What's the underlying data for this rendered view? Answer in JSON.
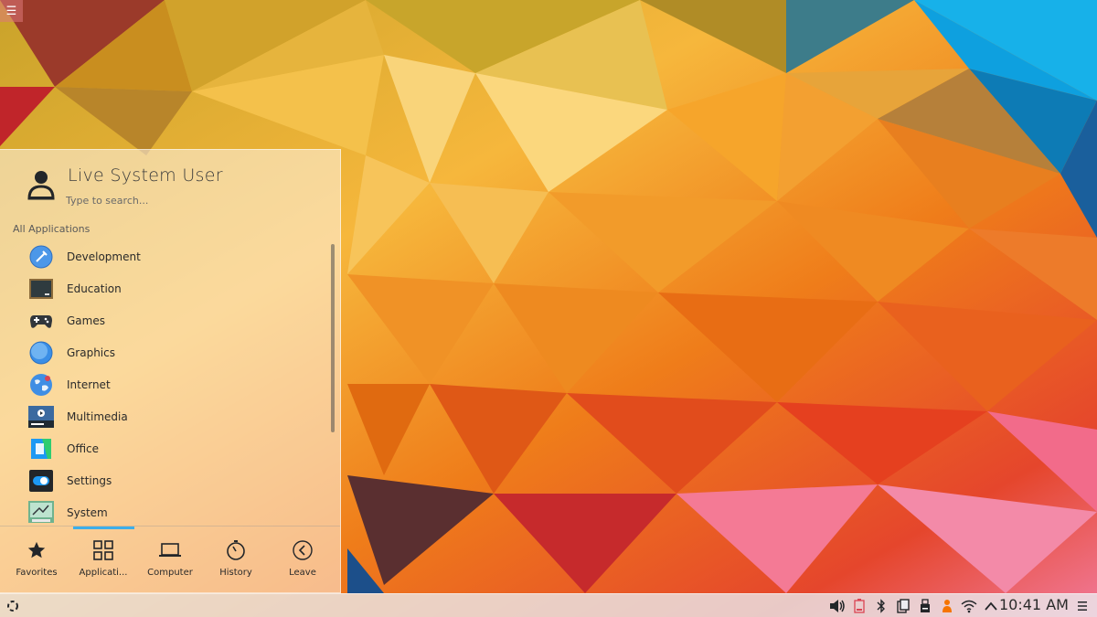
{
  "launcher": {
    "user_name": "Live System User",
    "search_placeholder": "Type to search...",
    "section_title": "All Applications",
    "applications": [
      {
        "label": "Development",
        "icon": "development-icon"
      },
      {
        "label": "Education",
        "icon": "education-icon"
      },
      {
        "label": "Games",
        "icon": "games-icon"
      },
      {
        "label": "Graphics",
        "icon": "graphics-icon"
      },
      {
        "label": "Internet",
        "icon": "internet-icon"
      },
      {
        "label": "Multimedia",
        "icon": "multimedia-icon"
      },
      {
        "label": "Office",
        "icon": "office-icon"
      },
      {
        "label": "Settings",
        "icon": "settings-icon"
      },
      {
        "label": "System",
        "icon": "system-icon"
      }
    ],
    "tabs": [
      {
        "label": "Favorites",
        "icon": "star-icon"
      },
      {
        "label": "Applicati...",
        "icon": "grid-icon",
        "active": true
      },
      {
        "label": "Computer",
        "icon": "laptop-icon"
      },
      {
        "label": "History",
        "icon": "clock-icon"
      },
      {
        "label": "Leave",
        "icon": "back-arrow-icon"
      }
    ]
  },
  "panel": {
    "clock": "10:41 AM",
    "tray_icons": [
      "volume-icon",
      "battery-icon",
      "bluetooth-icon",
      "clipboard-icon",
      "usb-drive-icon",
      "notification-icon",
      "wifi-icon",
      "chevron-up-icon"
    ]
  },
  "colors": {
    "accent": "#3daee9",
    "panel_background": "#ebeef2",
    "battery_warning": "#da4453",
    "notification": "#f67400"
  }
}
